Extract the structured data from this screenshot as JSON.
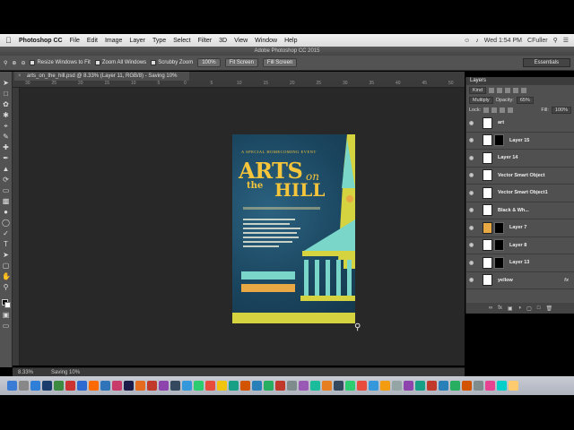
{
  "menubar": {
    "app_name": "Photoshop CC",
    "items": [
      "File",
      "Edit",
      "Image",
      "Layer",
      "Type",
      "Select",
      "Filter",
      "3D",
      "View",
      "Window",
      "Help"
    ],
    "clock": "Wed 1:54 PM",
    "user": "CFuller"
  },
  "window": {
    "title": "Adobe Photoshop CC 2015"
  },
  "options": {
    "resize_windows": "Resize Windows to Fit",
    "zoom_all": "Zoom All Windows",
    "scrubby_zoom": "Scrubby Zoom",
    "pct100": "100%",
    "fit_screen": "Fit Screen",
    "fill_screen": "Fill Screen",
    "workspace": "Essentials"
  },
  "document": {
    "tab_label": "arts_on_the_hill.psd @ 8.33% (Layer 11, RGB/8) - Saving 10%",
    "zoom": "8.33%",
    "status": "Saving 10%",
    "poster": {
      "kicker": "A SPECIAL HOMECOMING EVENT",
      "title_arts": "ARTS",
      "title_on": "on",
      "title_the": "the",
      "title_hill": "HILL"
    }
  },
  "ruler": {
    "ticks": [
      "30",
      "25",
      "20",
      "15",
      "10",
      "5",
      "0",
      "5",
      "10",
      "15",
      "20",
      "25",
      "30",
      "35",
      "40",
      "45",
      "50"
    ]
  },
  "layers_panel": {
    "title": "Layers",
    "kind": "Kind",
    "blend_mode": "Multiply",
    "opacity_label": "Opacity:",
    "opacity_value": "65%",
    "lock_label": "Lock:",
    "fill_label": "Fill:",
    "fill_value": "100%",
    "layers": [
      {
        "name": "art",
        "thumb": "#ffffff",
        "mask": false,
        "fx": false
      },
      {
        "name": "Layer 15",
        "thumb": "#ffffff",
        "mask": true,
        "fx": false
      },
      {
        "name": "Layer 14",
        "thumb": "#ffffff",
        "mask": false,
        "fx": false
      },
      {
        "name": "Vector Smart Object",
        "thumb": "#ffffff",
        "mask": false,
        "fx": false
      },
      {
        "name": "Vector Smart Object1",
        "thumb": "#ffffff",
        "mask": false,
        "fx": false
      },
      {
        "name": "Black & Wh...",
        "thumb": "#ffffff",
        "mask": false,
        "fx": false
      },
      {
        "name": "Layer 7",
        "thumb": "#e8a844",
        "mask": true,
        "fx": false
      },
      {
        "name": "Layer 8",
        "thumb": "#ffffff",
        "mask": true,
        "fx": false
      },
      {
        "name": "Layer 13",
        "thumb": "#ffffff",
        "mask": true,
        "fx": false
      },
      {
        "name": "yellow",
        "thumb": "#ffffff",
        "mask": false,
        "fx": true
      }
    ]
  },
  "colors": {
    "accent_yellow": "#f5c53b",
    "poster_blue": "#1d4a63",
    "teal": "#79d6c8",
    "orange": "#e8a844",
    "lime": "#d5d440"
  },
  "dock_colors": [
    "#3a7bd5",
    "#888888",
    "#2f7fd8",
    "#1a3d6e",
    "#3d8b40",
    "#cc3333",
    "#2a6ad1",
    "#ff6a00",
    "#2f73b9",
    "#c73a6a",
    "#1c1c4a",
    "#e56b1f",
    "#c0392b",
    "#8e44ad",
    "#34495e",
    "#3498db",
    "#2ecc71",
    "#e74c3c",
    "#f1c40f",
    "#16a085",
    "#d35400",
    "#2980b9",
    "#27ae60",
    "#c0392b",
    "#7f8c8d",
    "#9b59b6",
    "#1abc9c",
    "#e67e22",
    "#34495e",
    "#2ecc71",
    "#e74c3c",
    "#3498db",
    "#f39c12",
    "#95a5a6",
    "#8e44ad",
    "#16a085",
    "#c0392b",
    "#2980b9",
    "#27ae60",
    "#d35400",
    "#7f8c8d",
    "#e84393",
    "#00cec9",
    "#fdcb6e"
  ]
}
